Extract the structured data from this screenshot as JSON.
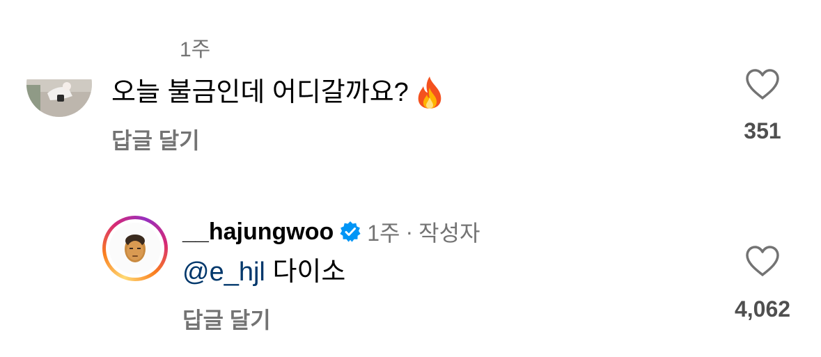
{
  "comments": [
    {
      "timestamp": "1주",
      "text": "오늘 불금인데 어디갈까요?",
      "emoji": "fire-emoji",
      "reply_label": "답글 달기",
      "like_count": "351",
      "avatar": "user-photo"
    },
    {
      "username": "__hajungwoo",
      "verified": true,
      "timestamp": "1주",
      "separator": "·",
      "author_badge": "작성자",
      "mention": "@e_hjl",
      "text": "다이소",
      "reply_label": "답글 달기",
      "like_count": "4,062",
      "avatar": "face-sticker",
      "story_ring": true
    }
  ],
  "colors": {
    "secondary_text": "#737373",
    "mention": "#00376b",
    "verified_badge": "#0095f6",
    "count_text": "#4f4f4f"
  },
  "icons": [
    "heart-icon",
    "verified-badge-icon",
    "fire-emoji"
  ]
}
